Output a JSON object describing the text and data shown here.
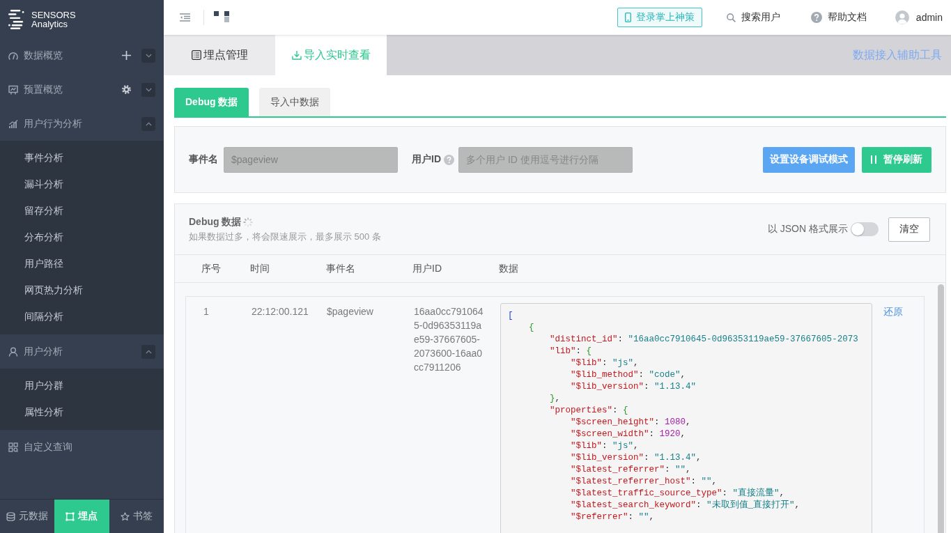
{
  "sidebar": {
    "logo": {
      "line1": "SENSORS",
      "line2": "Analytics"
    },
    "groups": [
      {
        "label": "数据概览",
        "kind": "group",
        "expanded": false
      },
      {
        "label": "预置概览",
        "kind": "group",
        "expanded": false
      },
      {
        "label": "用户行为分析",
        "kind": "group",
        "expanded": true,
        "children": [
          {
            "label": "事件分析"
          },
          {
            "label": "漏斗分析"
          },
          {
            "label": "留存分析"
          },
          {
            "label": "分布分析"
          },
          {
            "label": "用户路径"
          },
          {
            "label": "网页热力分析"
          },
          {
            "label": "间隔分析"
          }
        ]
      },
      {
        "label": "用户分析",
        "kind": "group",
        "expanded": true,
        "children": [
          {
            "label": "用户分群"
          },
          {
            "label": "属性分析"
          }
        ]
      },
      {
        "label": "自定义查询",
        "kind": "link"
      }
    ],
    "bottom_tabs": [
      {
        "label": "元数据",
        "selected": false
      },
      {
        "label": "埋点",
        "selected": true
      },
      {
        "label": "书签",
        "selected": false
      }
    ]
  },
  "top_bar": {
    "mobile_button": "登录掌上神策",
    "search": "搜索用户",
    "help": "帮助文档",
    "user": "admin"
  },
  "page_tabs": [
    {
      "label": "埋点管理",
      "selected": false
    },
    {
      "label": "导入实时查看",
      "selected": true
    }
  ],
  "tool_link": "数据接入辅助工具",
  "sub_tabs": [
    {
      "label": "Debug 数据",
      "selected": true
    },
    {
      "label": "导入中数据",
      "selected": false
    }
  ],
  "filter": {
    "event_name": {
      "label": "事件名",
      "value": "$pageview",
      "disabled": true
    },
    "user_id": {
      "label": "用户ID",
      "placeholder": "多个用户 ID 使用逗号进行分隔",
      "disabled": true
    },
    "buttons": [
      {
        "label": "设置设备调试模式",
        "kind": "primary"
      },
      {
        "label": "暂停刷新",
        "kind": "pause"
      }
    ]
  },
  "debug_panel": {
    "title": "Debug 数据",
    "loading": true,
    "note": "如果数据过多，将会限速展示，最多展示 500 条",
    "json_toggle": {
      "label": "以 JSON 格式展示",
      "on": false
    },
    "clear_button": "清空",
    "table": {
      "columns": [
        "序号",
        "时间",
        "事件名",
        "用户ID",
        "数据"
      ],
      "rows": [
        {
          "index": "1",
          "time": "22:12:00.121",
          "event": "$pageview",
          "user_id": "16aa0cc7910645-0d96353119ae59-37667605-2073600-16aa0cc7911206",
          "action": "还原",
          "data": [
            "[",
            "    {",
            "        \"distinct_id\": \"16aa0cc7910645-0d96353119ae59-37667605-2073",
            "        \"lib\": {",
            "            \"$lib\": \"js\",",
            "            \"$lib_method\": \"code\",",
            "            \"$lib_version\": \"1.13.4\"",
            "        },",
            "        \"properties\": {",
            "            \"$screen_height\": 1080,",
            "            \"$screen_width\": 1920,",
            "            \"$lib\": \"js\",",
            "            \"$lib_version\": \"1.13.4\",",
            "            \"$latest_referrer\": \"\",",
            "            \"$latest_referrer_host\": \"\",",
            "            \"$latest_traffic_source_type\": \"直接流量\",",
            "            \"$latest_search_keyword\": \"未取到值_直接打开\",",
            "            \"$referrer\": \"\","
          ]
        }
      ]
    }
  }
}
